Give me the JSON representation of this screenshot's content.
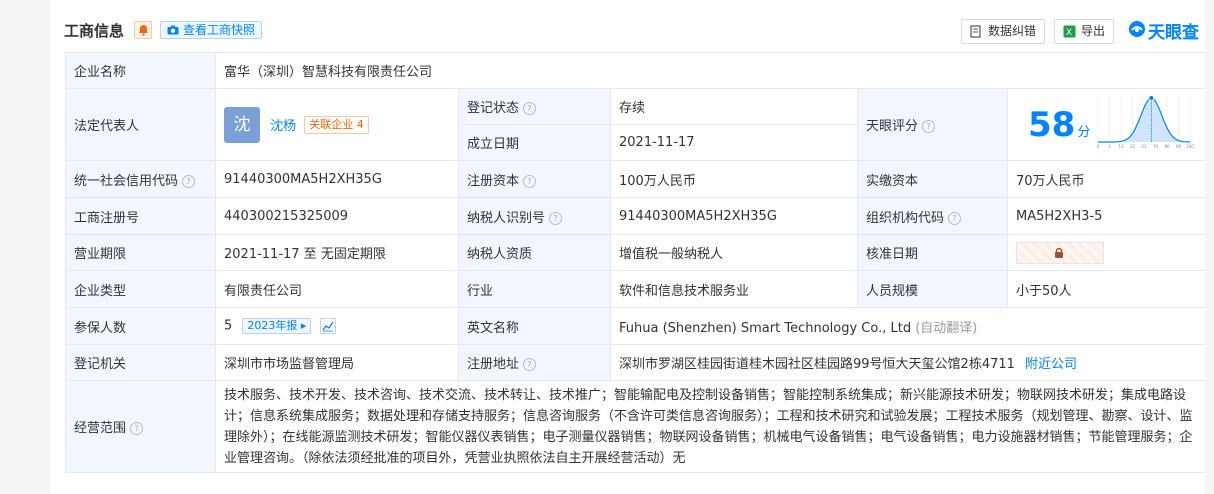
{
  "header": {
    "title": "工商信息",
    "snapshot_label": "查看工商快照",
    "correction_label": "数据纠错",
    "export_label": "导出",
    "logo_text": "天眼查"
  },
  "company": {
    "name_label": "企业名称",
    "name": "富华（深圳）智慧科技有限责任公司",
    "legal_rep_label": "法定代表人",
    "legal_rep_avatar": "沈",
    "legal_rep_name": "沈杨",
    "related_label": "关联企业",
    "related_count": "4",
    "reg_status_label": "登记状态",
    "reg_status": "存续",
    "founded_label": "成立日期",
    "founded": "2021-11-17",
    "score_label": "天眼评分",
    "score_value": "58",
    "score_unit": "分",
    "credit_code_label": "统一社会信用代码",
    "credit_code": "91440300MA5H2XH35G",
    "reg_capital_label": "注册资本",
    "reg_capital": "100万人民币",
    "paid_capital_label": "实缴资本",
    "paid_capital": "70万人民币",
    "reg_no_label": "工商注册号",
    "reg_no": "440300215325009",
    "taxpayer_id_label": "纳税人识别号",
    "taxpayer_id": "91440300MA5H2XH35G",
    "org_code_label": "组织机构代码",
    "org_code": "MA5H2XH3-5",
    "term_label": "营业期限",
    "term": "2021-11-17 至 无固定期限",
    "taxpayer_qual_label": "纳税人资质",
    "taxpayer_qual": "增值税一般纳税人",
    "approval_label": "核准日期",
    "type_label": "企业类型",
    "type": "有限责任公司",
    "industry_label": "行业",
    "industry": "软件和信息技术服务业",
    "staff_label": "人员规模",
    "staff": "小于50人",
    "insured_label": "参保人数",
    "insured": "5",
    "insured_year": "2023年报",
    "english_label": "英文名称",
    "english_name": "Fuhua (Shenzhen) Smart Technology Co., Ltd",
    "auto_translate": "(自动翻译)",
    "authority_label": "登记机关",
    "authority": "深圳市市场监督管理局",
    "address_label": "注册地址",
    "address": "深圳市罗湖区桂园街道桂木园社区桂园路99号恒大天玺公馆2栋4711",
    "nearby_label": "附近公司",
    "scope_label": "经营范围",
    "scope": "技术服务、技术开发、技术咨询、技术交流、技术转让、技术推广；智能输配电及控制设备销售；智能控制系统集成；新兴能源技术研发；物联网技术研发；集成电路设计；信息系统集成服务；数据处理和存储支持服务；信息咨询服务（不含许可类信息咨询服务）；工程和技术研究和试验发展；工程技术服务（规划管理、勘察、设计、监理除外）；在线能源监测技术研发；智能仪器仪表销售；电子测量仪器销售；物联网设备销售；机械电气设备销售；电气设备销售；电力设施器材销售；节能管理服务；企业管理咨询。（除依法须经批准的项目外，凭营业执照依法自主开展经营活动）无"
  },
  "score_chart": {
    "ticks": [
      "0",
      "1",
      "11",
      "32",
      "53",
      "70",
      "80",
      "90",
      "100"
    ],
    "marker_value": 58
  },
  "colors": {
    "accent": "#0084ff",
    "label_bg": "#f2f7ff",
    "status_green": "#00a854",
    "warning_orange": "#fa6400"
  },
  "icons": [
    "bell-icon",
    "camera-icon",
    "edit-icon",
    "excel-icon",
    "tianyancha-logo-icon",
    "question-icon",
    "lock-icon",
    "trend-chart-icon"
  ]
}
